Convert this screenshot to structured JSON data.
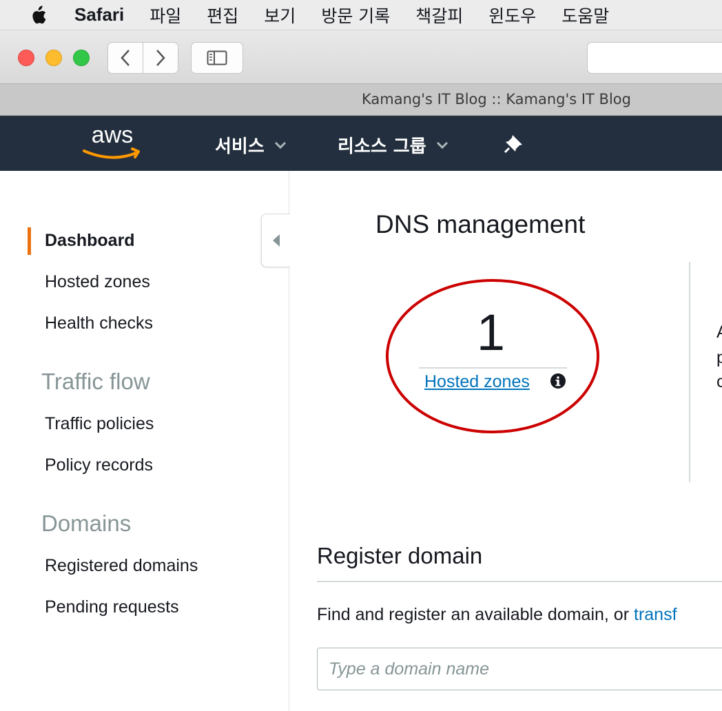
{
  "menubar": {
    "apple_icon": "apple-icon",
    "app_name": "Safari",
    "items": [
      "파일",
      "편집",
      "보기",
      "방문 기록",
      "책갈피",
      "윈도우",
      "도움말"
    ]
  },
  "browser": {
    "tab_title": "Kamang's IT Blog :: Kamang's IT Blog"
  },
  "aws_nav": {
    "logo_text": "aws",
    "services_label": "서비스",
    "resource_groups_label": "리소스 그룹",
    "pin_icon": "pin-icon"
  },
  "sidebar": {
    "items": [
      {
        "label": "Dashboard",
        "active": true
      },
      {
        "label": "Hosted zones"
      },
      {
        "label": "Health checks"
      }
    ],
    "traffic_flow": {
      "heading": "Traffic flow",
      "items": [
        "Traffic policies",
        "Policy records"
      ]
    },
    "domains": {
      "heading": "Domains",
      "items": [
        "Registered domains",
        "Pending requests"
      ]
    }
  },
  "main": {
    "title": "DNS management",
    "hosted_zones_count": "1",
    "hosted_zones_link": "Hosted zones",
    "edge_text": [
      "A",
      "p",
      "c"
    ],
    "register": {
      "title": "Register domain",
      "description": "Find and register an available domain, or ",
      "transfer_link": "transf",
      "input_placeholder": "Type a domain name"
    }
  },
  "colors": {
    "aws_nav_bg": "#232f3e",
    "accent_orange": "#ec7211",
    "link_blue": "#0073bb",
    "annotation_red": "#cc0000"
  }
}
